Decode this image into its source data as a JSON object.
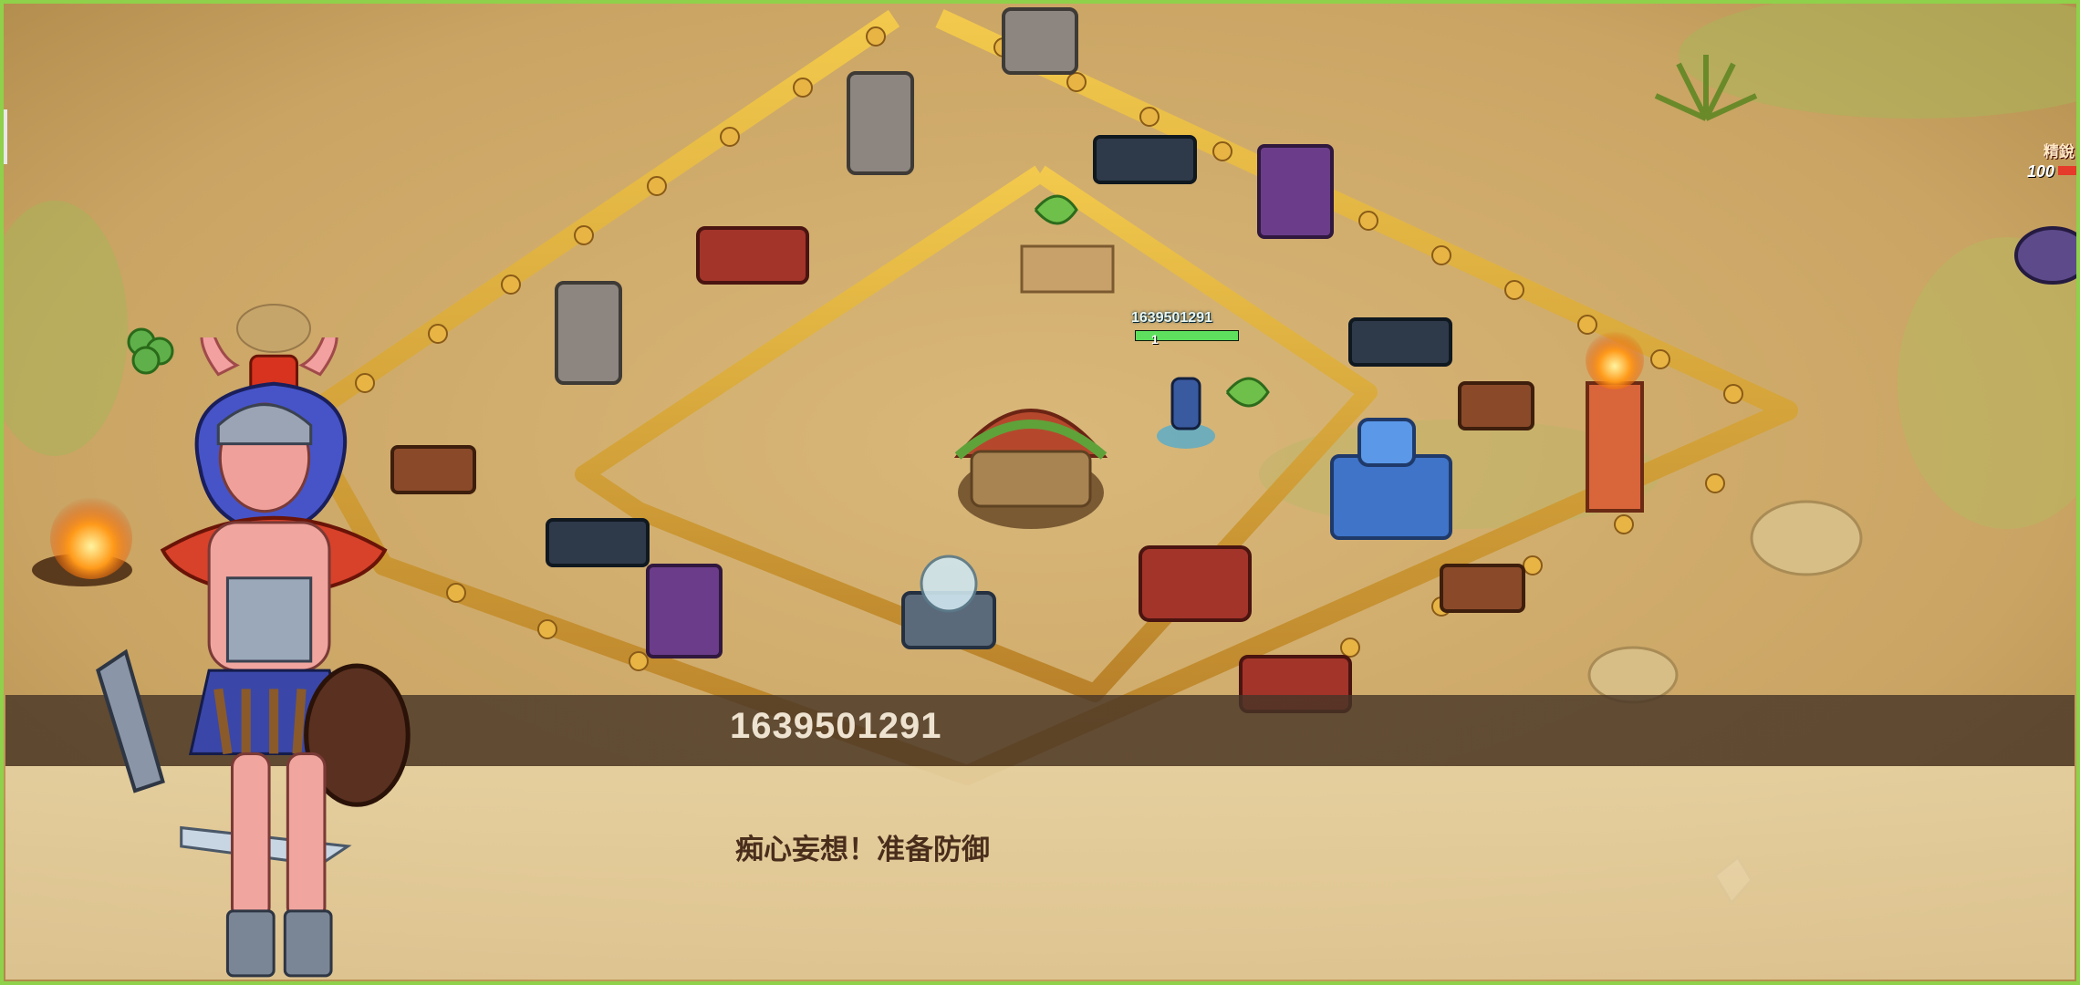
{
  "dialog": {
    "speaker": "1639501291",
    "line": "痴心妄想！准备防御"
  },
  "player": {
    "tag": "1639501291",
    "level": "1",
    "hp_fraction": 1.0
  },
  "enemy": {
    "label": "精銳",
    "level": "100",
    "hp_fraction": 1.0
  },
  "colors": {
    "frame_border": "#8fd14a",
    "ground": "#c9a765",
    "wall_gold": "#d9a43a",
    "dialog_band": "#463426",
    "dialog_text": "#4a2e1c"
  },
  "icons": [
    "warrior-portrait-icon",
    "town-hall-icon",
    "flag-icon",
    "crossbow-tower-icon",
    "cannon-icon",
    "crystal-icon",
    "campfire-icon"
  ]
}
